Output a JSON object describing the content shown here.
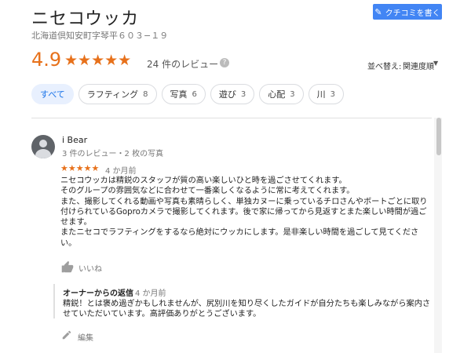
{
  "place": {
    "name": "ニセコウッカ",
    "address": "北海道倶知安町字琴平６０３−１９"
  },
  "header": {
    "write_review_label": "クチコミを書く"
  },
  "rating": {
    "value": "4.9",
    "stars": "★★★★★",
    "review_count": "24 件のレビュー",
    "help_glyph": "?"
  },
  "sort": {
    "label": "並べ替え:",
    "value": "関連度順",
    "caret": "▼"
  },
  "filters": [
    {
      "label": "すべて",
      "count": ""
    },
    {
      "label": "ラフティング",
      "count": "8"
    },
    {
      "label": "写真",
      "count": "6"
    },
    {
      "label": "遊び",
      "count": "3"
    },
    {
      "label": "心配",
      "count": "3"
    },
    {
      "label": "川",
      "count": "3"
    }
  ],
  "review": {
    "author": "i Bear",
    "meta": "3 件のレビュー・2 枚の写真",
    "stars": "★★★★★",
    "date": "4 か月前",
    "paragraphs": [
      "ニセコウッカは精鋭のスタッフが質の高い楽しいひと時を過ごさせてくれます。",
      "そのグループの雰囲気などに合わせて一番楽しくなるように常に考えてくれます。",
      "また、撮影してくれる動画や写真も素晴らしく、単独カヌーに乗っているチロさんやボートごとに取り付けられているGoproカメラで撮影してくれます。後で家に帰ってから見返すとまた楽しい時間が過ごせます。",
      "またニセコでラフティングをするなら絶対にウッカにします。是非楽しい時間を過ごして見てください。"
    ],
    "like_label": "いいね"
  },
  "owner_response": {
    "title": "オーナーからの返信",
    "date": "4 か月前",
    "text": "精鋭！とは褒め過ぎかもしれませんが、尻別川を知り尽くしたガイドが自分たちも楽しみながら案内させていただいています。高評価ありがとうございます。",
    "edit_label": "編集"
  },
  "colors": {
    "star": "#e7711b",
    "accent": "#4285f4",
    "active_chip_bg": "#e8f0fe"
  },
  "icons": {
    "write": "pencil-icon",
    "help": "help-icon",
    "like": "thumb-up-icon",
    "edit": "pencil-icon",
    "avatar": "person-avatar"
  }
}
